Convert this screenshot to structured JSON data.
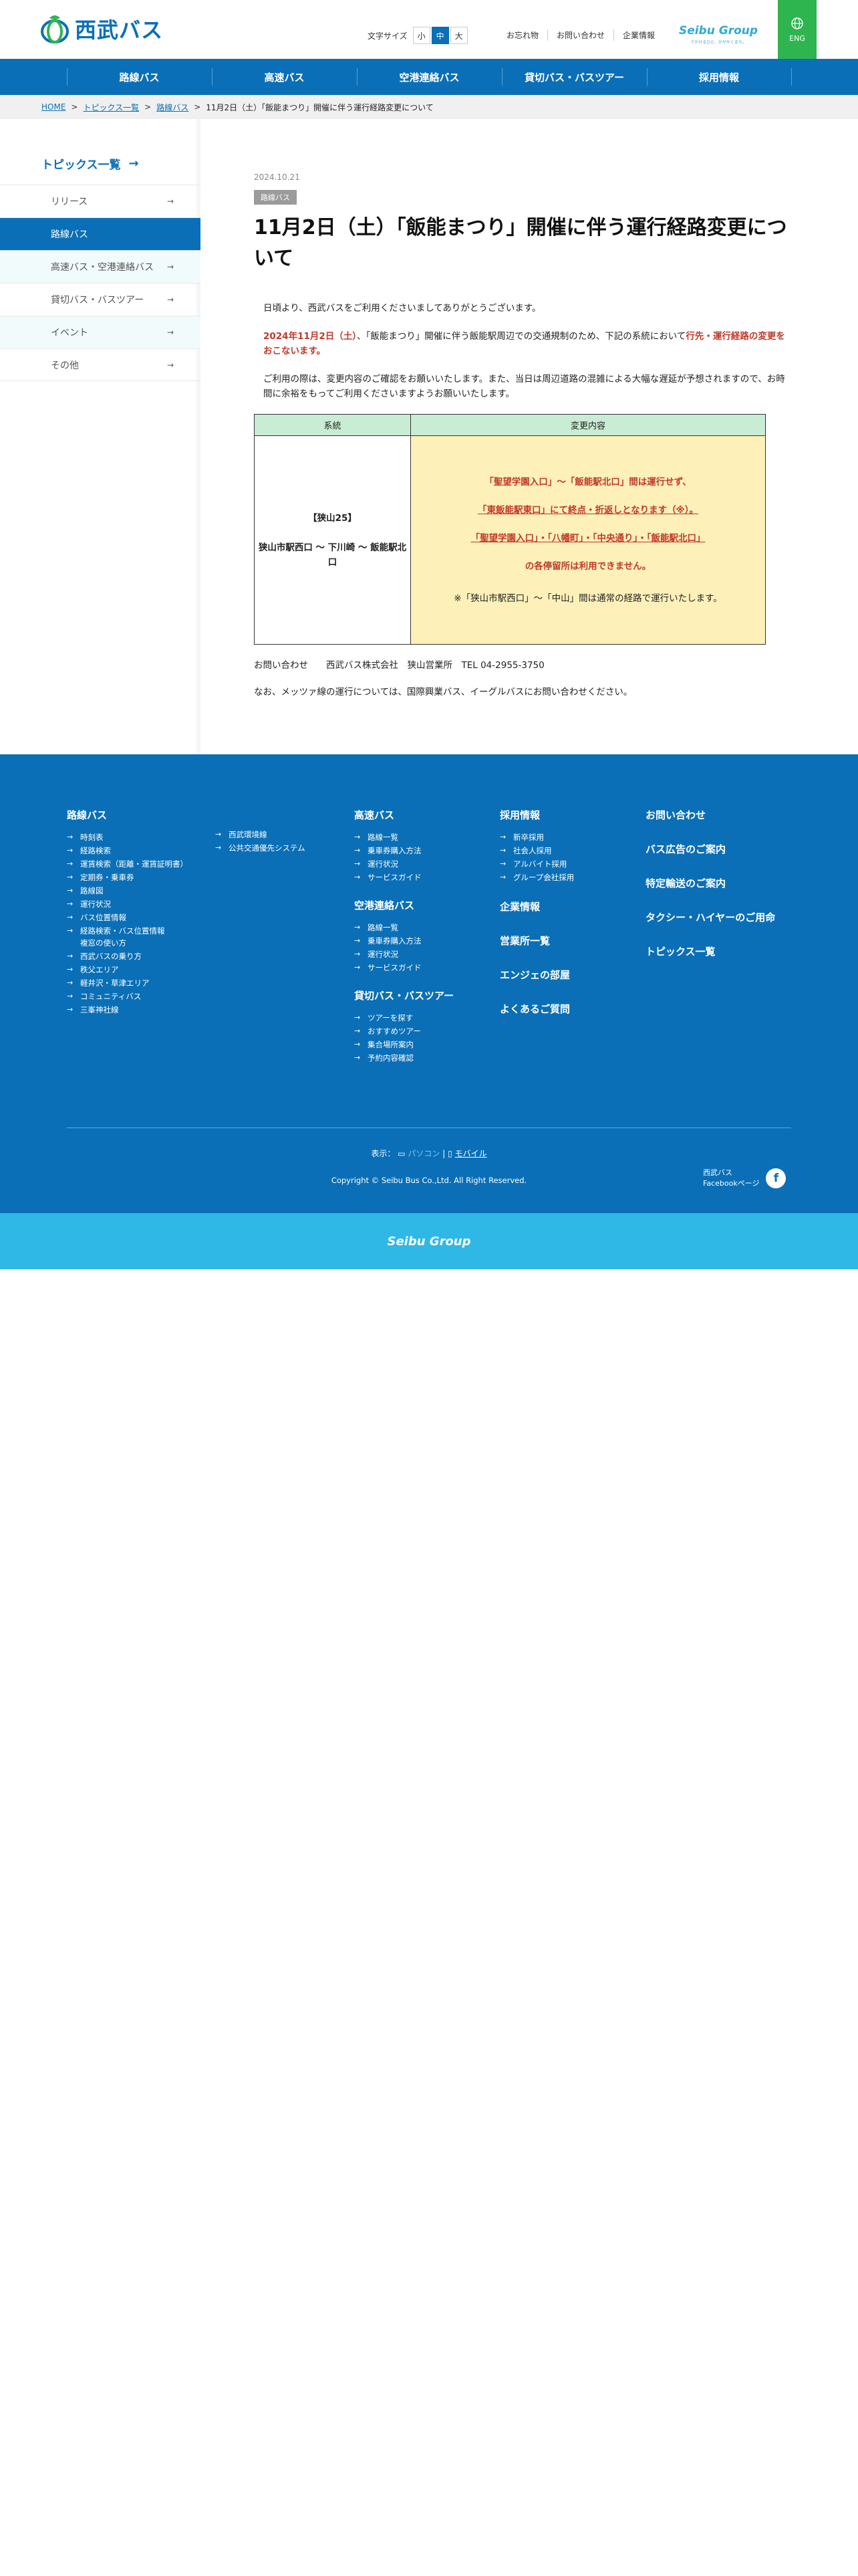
{
  "header": {
    "logo_text": "西武バス",
    "font_size_label": "文字サイズ",
    "font_sizes": [
      "小",
      "中",
      "大"
    ],
    "links": [
      "お忘れ物",
      "お問い合わせ",
      "企業情報"
    ],
    "group_logo": "Seibu Group",
    "group_sub": "でかけるひと、かがやくまち。",
    "eng_label": "ENG"
  },
  "nav": [
    "路線バス",
    "高速バス",
    "空港連絡バス",
    "貸切バス・バスツアー",
    "採用情報"
  ],
  "breadcrumb": [
    "HOME",
    "トピックス一覧",
    "路線バス",
    "11月2日（土）「飯能まつり」開催に伴う運行経路変更について"
  ],
  "sidebar": {
    "title": "トピックス一覧",
    "items": [
      "リリース",
      "路線バス",
      "高速バス・空港連絡バス",
      "貸切バス・バスツアー",
      "イベント",
      "その他"
    ]
  },
  "article": {
    "date": "2024.10.21",
    "category": "路線バス",
    "title": "11月2日（土）「飯能まつり」開催に伴う運行経路変更について",
    "p1": "日頃より、西武バスをご利用くださいましてありがとうございます。",
    "p2_red1": "2024年11月2日（土）",
    "p2_mid": "、「飯能まつり」開催に伴う飯能駅周辺での交通規制のため、下記の系統において",
    "p2_red2": "行先・運行経路の変更をおこないます。",
    "p3": "ご利用の際は、変更内容のご確認をお願いいたします。また、当日は周辺道路の混雑による大幅な遅延が予想されますので、お時間に余裕をもってご利用くださいますようお願いいたします。",
    "table": {
      "col1": "系統",
      "col2": "変更内容",
      "route_id": "【狭山25】",
      "route_name": "狭山市駅西口 〜 下川崎 〜 飯能駅北口",
      "line1": "「聖望学園入口」〜「飯能駅北口」間は運行せず、",
      "line2": "「東飯能駅東口」にて終点・折返しとなります（※）。",
      "line3": "「聖望学園入口」・「八幡町」・「中央通り」・「飯能駅北口」",
      "line4": "の各停留所は利用できません。",
      "note": "※「狭山市駅西口」〜「中山」間は通常の経路で運行いたします。"
    },
    "contact": "お問い合わせ　　西武バス株式会社　狭山営業所　TEL 04-2955-3750",
    "note": "なお、メッツァ線の運行については、国際興業バス、イーグルバスにお問い合わせください。"
  },
  "footer": {
    "col1_head": "路線バス",
    "col1_links": [
      "時刻表",
      "経路検索",
      "運賃検索（距離・運賃証明書）",
      "定期券・乗車券",
      "路線図",
      "運行状況",
      "バス位置情報",
      "経路検索・バス位置情報\n複窓の使い方",
      "西武バスの乗り方",
      "秩父エリア",
      "軽井沢・草津エリア",
      "コミュニティバス",
      "三峯神社線"
    ],
    "col1b_links": [
      "西武環境線",
      "公共交通優先システム"
    ],
    "col2_head": "高速バス",
    "col2_links": [
      "路線一覧",
      "乗車券購入方法",
      "運行状況",
      "サービスガイド"
    ],
    "col2b_head": "空港連絡バス",
    "col2b_links": [
      "路線一覧",
      "乗車券購入方法",
      "運行状況",
      "サービスガイド"
    ],
    "col2c_head": "貸切バス・バスツアー",
    "col2c_links": [
      "ツアーを探す",
      "おすすめツアー",
      "集合場所案内",
      "予約内容確認"
    ],
    "col3_head": "採用情報",
    "col3_links": [
      "新卒採用",
      "社会人採用",
      "アルバイト採用",
      "グループ会社採用"
    ],
    "col3_big": [
      "企業情報",
      "営業所一覧",
      "エンジェの部屋",
      "よくあるご質問"
    ],
    "col4_big": [
      "お問い合わせ",
      "バス広告のご案内",
      "特定輸送のご案内",
      "タクシー・ハイヤーのご用命",
      "トピックス一覧"
    ],
    "display_label": "表示：",
    "display_pc": "パソコン",
    "display_mobile": "モバイル",
    "copyright": "Copyright © Seibu Bus Co.,Ltd. All Right Reserved.",
    "facebook": "西武バス\nFacebookページ"
  },
  "bottom_logo": "Seibu Group"
}
